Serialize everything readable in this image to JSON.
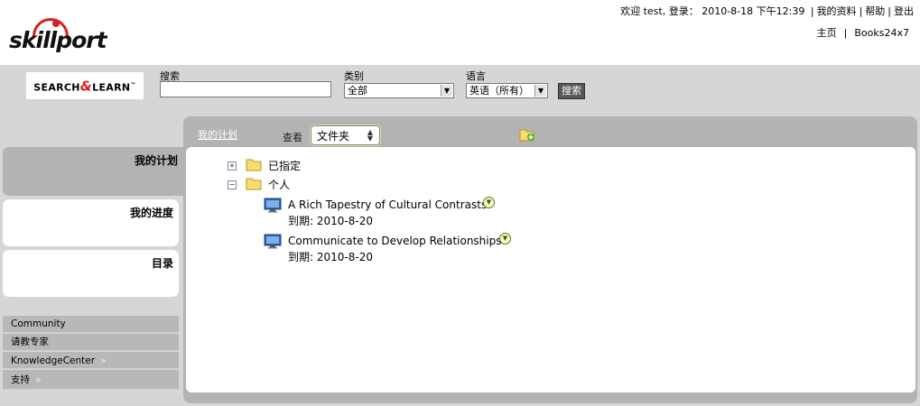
{
  "header": {
    "logo_text": "skillport",
    "user_bar": {
      "welcome": "欢迎 test, 登录：",
      "datetime": "2010-8-18 下午12:39",
      "my_profile": "我的资料",
      "help": "帮助",
      "logout": "登出"
    },
    "nav": {
      "home": "主页",
      "books": "Books24x7"
    }
  },
  "search": {
    "logo_text_left": "SEARCH",
    "logo_text_amp": "&",
    "logo_text_right": "LEARN",
    "logo_tm": "™",
    "search_label": "搜索",
    "search_value": "",
    "category_label": "类别",
    "category_value": "全部",
    "language_label": "语言",
    "language_value": "英语（所有）",
    "button_label": "搜索"
  },
  "sidebar": {
    "tabs": [
      {
        "label": "我的计划",
        "active": true
      },
      {
        "label": "我的进度",
        "active": false
      },
      {
        "label": "目录",
        "active": false
      }
    ],
    "links": [
      {
        "label": "Community",
        "has_chevron": false
      },
      {
        "label": "请教专家",
        "has_chevron": false
      },
      {
        "label": "KnowledgeCenter",
        "has_chevron": true
      },
      {
        "label": "支持",
        "has_chevron": true
      }
    ],
    "chevron": "»"
  },
  "main": {
    "breadcrumb": "我的计划",
    "view_label": "查看",
    "view_value": "文件夹",
    "tree": {
      "assigned": {
        "label": "已指定",
        "toggle": "+"
      },
      "personal": {
        "label": "个人",
        "toggle": "−"
      },
      "courses": [
        {
          "title": "A Rich Tapestry of Cultural Contrasts",
          "due_label": "到期:",
          "due_date": "2010-8-20"
        },
        {
          "title": "Communicate to Develop Relationships",
          "due_label": "到期:",
          "due_date": "2010-8-20"
        }
      ]
    }
  },
  "colors": {
    "brand_red": "#d8201f",
    "band_gray": "#d6d6d6",
    "panel_gray": "#b3b3b3",
    "folder_yellow": "#f7dc6f",
    "monitor_blue": "#2f66b8"
  }
}
